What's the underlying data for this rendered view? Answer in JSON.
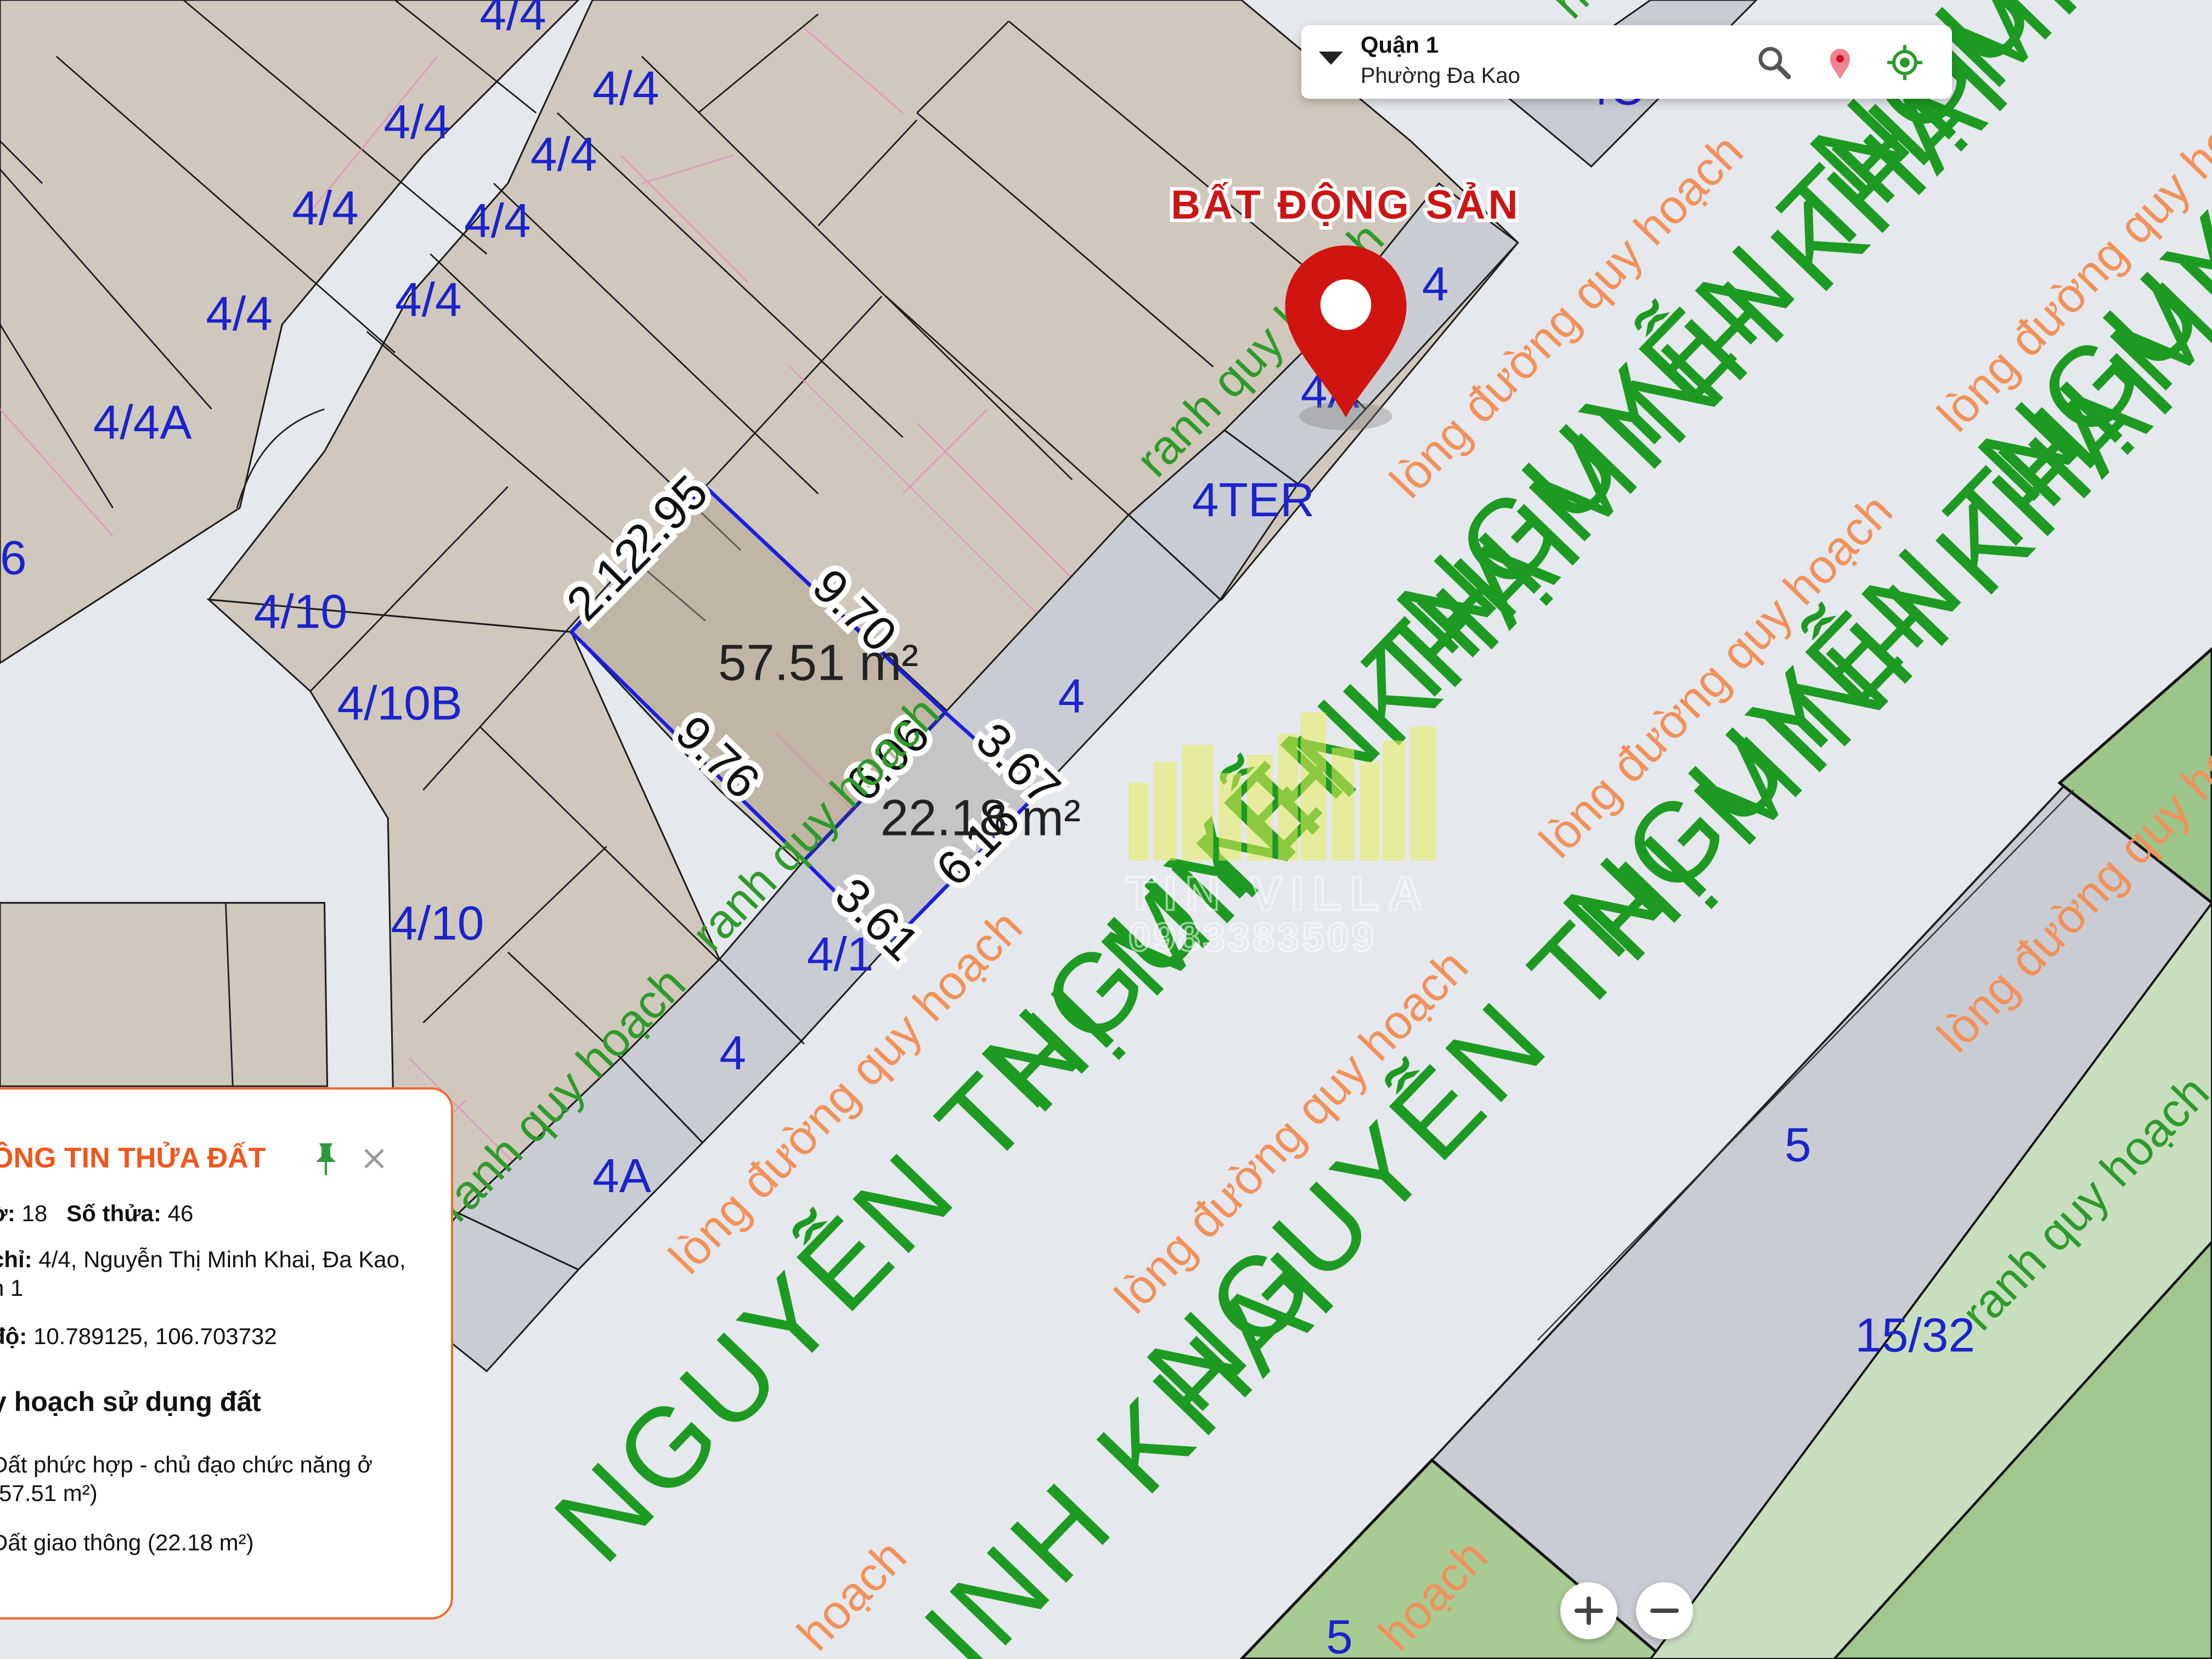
{
  "header": {
    "district": "Quận 1",
    "ward": "Phường Đa Kao",
    "search_icon": "search-icon",
    "marker_icon": "map-marker-icon",
    "locate_icon": "crosshair-locate-icon"
  },
  "map": {
    "brand_label": "BẤT ĐỘNG SẢN",
    "watermark_name": "TIN VILLA",
    "watermark_phone": "0983383509",
    "street_name": "NGUYỄN THỊ MINH KHAI",
    "street_fragment_1": "NGUYỄN THỊ M",
    "street_fragment_2": "INH KHAI",
    "street_fragment_3": "NGUYỄN THỊ MI",
    "plan_road_label": "lòng đường quy hoạch",
    "plan_boundary_label": "ranh quy hoạch",
    "plan_fragment": "hoạch",
    "parcel_labels": {
      "p44": "4/4",
      "p44a": "4/4A",
      "p410": "4/10",
      "p410b": "4/10B",
      "p4": "4",
      "p4a": "4A",
      "p4ter": "4TER",
      "p41": "4/1",
      "p4c": "4C",
      "p5": "5",
      "p1532": "15/32",
      "p6": "6"
    },
    "selected_parcel": {
      "area_main": "57.51 m²",
      "area_road": "22.18 m²",
      "dims": [
        "2.95",
        "9.70",
        "2.12",
        "9.76",
        "3.67",
        "6.06",
        "6.16",
        "3.61"
      ]
    },
    "colors": {
      "land": "#d0c8bc",
      "road_strip": "#c8ccd2",
      "background": "#e5e8ec",
      "green_zone": "#9cc58a",
      "selection": "#1a1ee0",
      "marker": "#cc1515"
    }
  },
  "info_panel": {
    "title": "ÔNG TIN THỬA ĐẤT",
    "sheet_label": "ờ:",
    "sheet_value": "18",
    "parcel_label": "Số thửa:",
    "parcel_value": "46",
    "address_label": "chỉ:",
    "address_value": "4/4, Nguyễn Thị Minh Khai, Đa Kao,",
    "address_line2": "n 1",
    "coords_label": "độ:",
    "coords_value": "10.789125, 106.703732",
    "planning_heading": "y hoạch sử dụng đất",
    "use_1_line1": "Đất phức hợp - chủ đạo chức năng ở",
    "use_1_line2": "(57.51 m²)",
    "use_2": "Đất giao thông (22.18 m²)",
    "pin_icon": "pin-icon",
    "close_icon": "close-icon"
  },
  "zoom": {
    "in_icon": "plus-icon",
    "out_icon": "minus-icon"
  }
}
